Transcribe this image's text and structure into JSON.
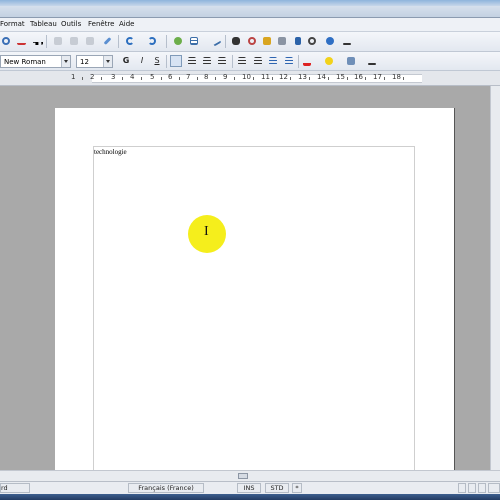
{
  "menubar": {
    "items": [
      "Format",
      "Tableau",
      "Outils",
      "Fenêtre",
      "Aide"
    ]
  },
  "formatting": {
    "font_name": "New Roman",
    "font_size": "12",
    "bold": "G",
    "italic": "I",
    "underline": "S"
  },
  "ruler": {
    "numbers": [
      "1",
      "2",
      "3",
      "4",
      "5",
      "6",
      "7",
      "8",
      "9",
      "10",
      "11",
      "12",
      "13",
      "14",
      "15",
      "16",
      "17",
      "18"
    ]
  },
  "document": {
    "text": "technologie",
    "cursor_symbol": "I"
  },
  "statusbar": {
    "left": "rd",
    "language": "Français (France)",
    "mode_ins": "INS",
    "mode_std": "STD",
    "modified": "*"
  },
  "colors": {
    "highlight": "#f5ee1c",
    "page": "#ffffff",
    "workspace": "#a9a9a9"
  },
  "icons": [
    "new-icon",
    "spellcheck-icon",
    "autospell-icon",
    "undo-icon",
    "redo-icon",
    "brush-icon",
    "hyperlink-icon",
    "table-icon",
    "show-draw-icon",
    "find-icon",
    "navigator-icon",
    "gallery-icon",
    "datasource-icon",
    "nonprinting-icon",
    "zoom-icon",
    "help-icon"
  ]
}
